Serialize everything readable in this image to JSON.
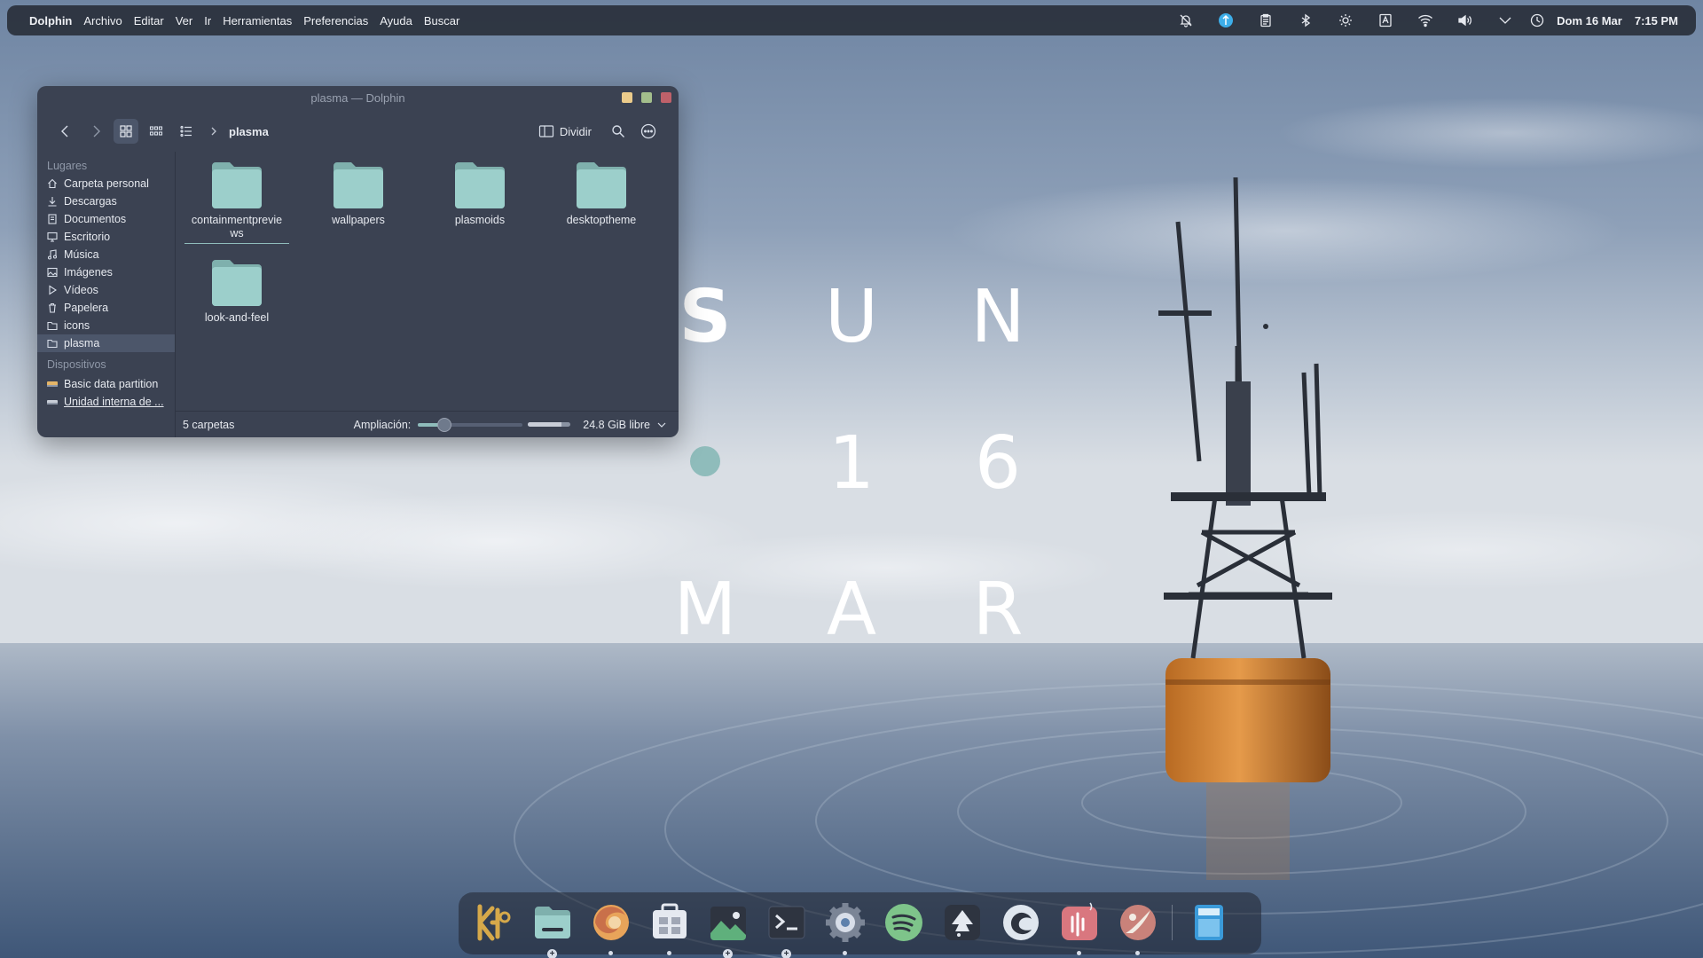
{
  "topbar": {
    "app_name": "Dolphin",
    "menus": [
      "Archivo",
      "Editar",
      "Ver",
      "Ir",
      "Herramientas",
      "Preferencias",
      "Ayuda",
      "Buscar"
    ],
    "tray_icons": [
      "bell-icon",
      "kde-connect-icon",
      "clipboard-icon",
      "bluetooth-icon",
      "brightness-icon",
      "keyboard-layout-icon",
      "wifi-icon",
      "volume-icon",
      "chevron-down-icon",
      "night-light-icon"
    ],
    "date": "Dom 16 Mar",
    "time": "7:15 PM"
  },
  "window": {
    "title": "plasma — Dolphin",
    "button_colors": {
      "minimize": "#ebcb8b",
      "maximize": "#a3be8c",
      "close": "#bf616a"
    },
    "toolbar": {
      "current_folder": "plasma",
      "split_label": "Dividir",
      "active_view": "icons"
    },
    "sidebar": {
      "places_title": "Lugares",
      "places": [
        {
          "label": "Carpeta personal",
          "icon": "home-icon"
        },
        {
          "label": "Descargas",
          "icon": "download-icon"
        },
        {
          "label": "Documentos",
          "icon": "document-icon"
        },
        {
          "label": "Escritorio",
          "icon": "desktop-icon"
        },
        {
          "label": "Música",
          "icon": "music-icon"
        },
        {
          "label": "Imágenes",
          "icon": "image-icon"
        },
        {
          "label": "Vídeos",
          "icon": "video-icon"
        },
        {
          "label": "Papelera",
          "icon": "trash-icon"
        },
        {
          "label": "icons",
          "icon": "folder-icon"
        },
        {
          "label": "plasma",
          "icon": "folder-icon"
        }
      ],
      "devices_title": "Dispositivos",
      "devices": [
        {
          "label": "Basic data partition",
          "icon": "drive-icon"
        },
        {
          "label": "Unidad interna de ...",
          "icon": "drive-icon"
        }
      ]
    },
    "folders": [
      {
        "name": "containmentpreviews"
      },
      {
        "name": "wallpapers"
      },
      {
        "name": "plasmoids"
      },
      {
        "name": "desktoptheme"
      },
      {
        "name": "look-and-feel"
      }
    ],
    "status": {
      "count": "5 carpetas",
      "zoom_label": "Ampliación:",
      "zoom_level": 0.25,
      "free_space": "24.8 GiB libre",
      "space_used_fraction": 0.78
    },
    "accent_color": "#8fbcbb"
  },
  "clock_widget": {
    "row1": [
      "S",
      "U",
      "N"
    ],
    "row2": [
      "1",
      "6"
    ],
    "row3": [
      "M",
      "A",
      "R"
    ],
    "dot_color": "#8fbcbb"
  },
  "dock": {
    "apps": [
      {
        "name": "kde-icon",
        "indicator": "none"
      },
      {
        "name": "dolphin-icon",
        "indicator": "plus"
      },
      {
        "name": "firefox-icon",
        "indicator": "dot"
      },
      {
        "name": "discover-icon",
        "indicator": "dot"
      },
      {
        "name": "gwenview-icon",
        "indicator": "plus"
      },
      {
        "name": "konsole-icon",
        "indicator": "plus"
      },
      {
        "name": "system-settings-icon",
        "indicator": "dot"
      },
      {
        "name": "spotify-icon",
        "indicator": "none"
      },
      {
        "name": "inkscape-icon",
        "indicator": "none"
      },
      {
        "name": "edge-icon",
        "indicator": "none"
      },
      {
        "name": "audio-app-icon",
        "indicator": "dot"
      },
      {
        "name": "krita-icon",
        "indicator": "dot"
      },
      {
        "name": "calculator-icon",
        "indicator": "none"
      }
    ]
  }
}
